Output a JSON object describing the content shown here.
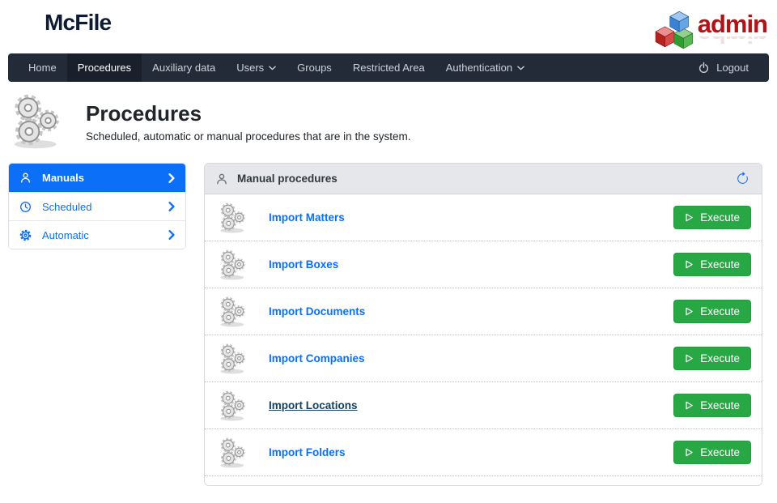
{
  "brand": {
    "name": "McFile",
    "logo_icon": "mcfile-diamond-logo-icon"
  },
  "user_badge": {
    "label": "admin",
    "icon": "admin-cubes-icon",
    "color": "#b01318"
  },
  "navbar": {
    "background": "#232b38",
    "items": [
      {
        "label": "Home",
        "active": false,
        "dropdown": false
      },
      {
        "label": "Procedures",
        "active": true,
        "dropdown": false
      },
      {
        "label": "Auxiliary data",
        "active": false,
        "dropdown": false
      },
      {
        "label": "Users",
        "active": false,
        "dropdown": true
      },
      {
        "label": "Groups",
        "active": false,
        "dropdown": false
      },
      {
        "label": "Restricted Area",
        "active": false,
        "dropdown": false
      },
      {
        "label": "Authentication",
        "active": false,
        "dropdown": true
      }
    ],
    "logout": {
      "label": "Logout",
      "icon": "power-icon"
    }
  },
  "page_header": {
    "title": "Procedures",
    "subtitle": "Scheduled, automatic or manual procedures that are in the system.",
    "icon": "gears-icon"
  },
  "sidebar": {
    "items": [
      {
        "label": "Manuals",
        "icon": "person-icon",
        "active": true,
        "chevron": "chevron-right-icon"
      },
      {
        "label": "Scheduled",
        "icon": "clock-icon",
        "active": false,
        "chevron": "chevron-right-icon"
      },
      {
        "label": "Automatic",
        "icon": "gear-icon",
        "active": false,
        "chevron": "chevron-right-icon"
      }
    ]
  },
  "panel": {
    "title": "Manual procedures",
    "title_icon": "person-icon",
    "refresh_icon": "refresh-icon",
    "rows": [
      {
        "label": "Import Matters",
        "icon": "gears-icon",
        "button_label": "Execute",
        "button_icon": "play-icon",
        "hovered": false
      },
      {
        "label": "Import Boxes",
        "icon": "gears-icon",
        "button_label": "Execute",
        "button_icon": "play-icon",
        "hovered": false
      },
      {
        "label": "Import Documents",
        "icon": "gears-icon",
        "button_label": "Execute",
        "button_icon": "play-icon",
        "hovered": false
      },
      {
        "label": "Import Companies",
        "icon": "gears-icon",
        "button_label": "Execute",
        "button_icon": "play-icon",
        "hovered": false
      },
      {
        "label": "Import Locations",
        "icon": "gears-icon",
        "button_label": "Execute",
        "button_icon": "play-icon",
        "hovered": true
      },
      {
        "label": "Import Folders",
        "icon": "gears-icon",
        "button_label": "Execute",
        "button_icon": "play-icon",
        "hovered": false
      }
    ]
  },
  "colors": {
    "primary_blue": "#0b6ff7",
    "success_green": "#28a745",
    "navbar_dark": "#232b38",
    "navbar_active": "#19202c",
    "panel_header_gray": "#e5e7ea",
    "admin_red": "#b01318",
    "link_hover_dark": "#15405f"
  }
}
